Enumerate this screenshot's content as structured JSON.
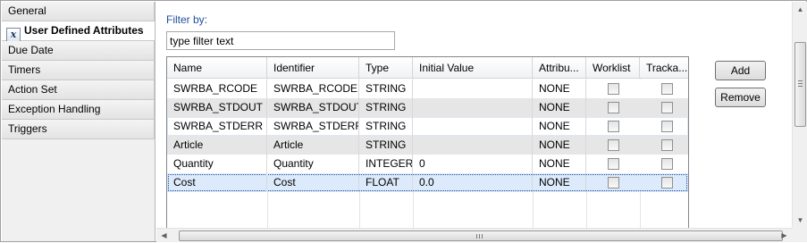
{
  "tabs": [
    {
      "label": "General",
      "icon": null,
      "active": false
    },
    {
      "label": "User Defined Attributes",
      "icon": "x-variable-icon",
      "active": true
    },
    {
      "label": "Due Date",
      "icon": null,
      "active": false
    },
    {
      "label": "Timers",
      "icon": null,
      "active": false
    },
    {
      "label": "Action Set",
      "icon": null,
      "active": false
    },
    {
      "label": "Exception Handling",
      "icon": null,
      "active": false
    },
    {
      "label": "Triggers",
      "icon": null,
      "active": false
    }
  ],
  "filter": {
    "label": "Filter by:",
    "value": "type filter text"
  },
  "table": {
    "columns": [
      "Name",
      "Identifier",
      "Type",
      "Initial Value",
      "Attribu...",
      "Worklist",
      "Tracka..."
    ],
    "rows": [
      {
        "name": "SWRBA_RCODE",
        "identifier": "SWRBA_RCODE",
        "type": "STRING",
        "initial_value": "",
        "attribute": "NONE",
        "worklist": false,
        "trackable": false
      },
      {
        "name": "SWRBA_STDOUT",
        "identifier": "SWRBA_STDOUT",
        "type": "STRING",
        "initial_value": "",
        "attribute": "NONE",
        "worklist": false,
        "trackable": false
      },
      {
        "name": "SWRBA_STDERR",
        "identifier": "SWRBA_STDERR",
        "type": "STRING",
        "initial_value": "",
        "attribute": "NONE",
        "worklist": false,
        "trackable": false
      },
      {
        "name": "Article",
        "identifier": "Article",
        "type": "STRING",
        "initial_value": "",
        "attribute": "NONE",
        "worklist": false,
        "trackable": false
      },
      {
        "name": "Quantity",
        "identifier": "Quantity",
        "type": "INTEGER",
        "initial_value": "0",
        "attribute": "NONE",
        "worklist": false,
        "trackable": false
      },
      {
        "name": "Cost",
        "identifier": "Cost",
        "type": "FLOAT",
        "initial_value": "0.0",
        "attribute": "NONE",
        "worklist": false,
        "trackable": false
      }
    ],
    "selected_row": 5
  },
  "buttons": {
    "add": "Add",
    "remove": "Remove"
  },
  "scrollbars": {
    "h_grip": "III",
    "v_grip": "≡"
  }
}
